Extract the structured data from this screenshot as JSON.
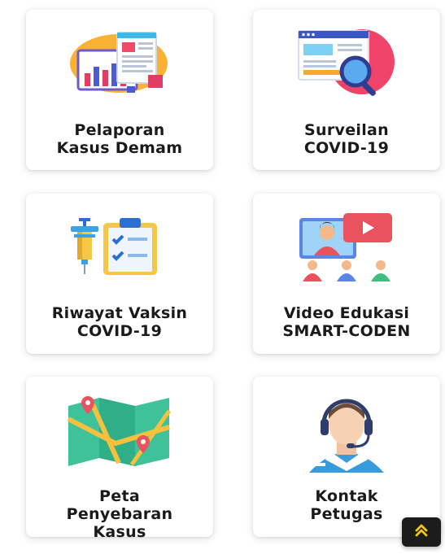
{
  "menu": {
    "cards": [
      {
        "label": "Pelaporan\nKasus Demam",
        "icon": "report-chart-icon"
      },
      {
        "label": "Surveilan\nCOVID-19",
        "icon": "surveillance-search-icon"
      },
      {
        "label": "Riwayat Vaksin\nCOVID-19",
        "icon": "vaccine-clipboard-icon"
      },
      {
        "label": "Video Edukasi\nSMART-CODEN",
        "icon": "video-education-icon"
      },
      {
        "label": "Peta\nPenyebaran\nKasus",
        "icon": "map-pins-icon"
      },
      {
        "label": "Kontak\nPetugas",
        "icon": "headset-agent-icon"
      }
    ]
  },
  "scroll_top": {
    "icon": "double-chevron-up-icon",
    "color": "#f5c518"
  }
}
